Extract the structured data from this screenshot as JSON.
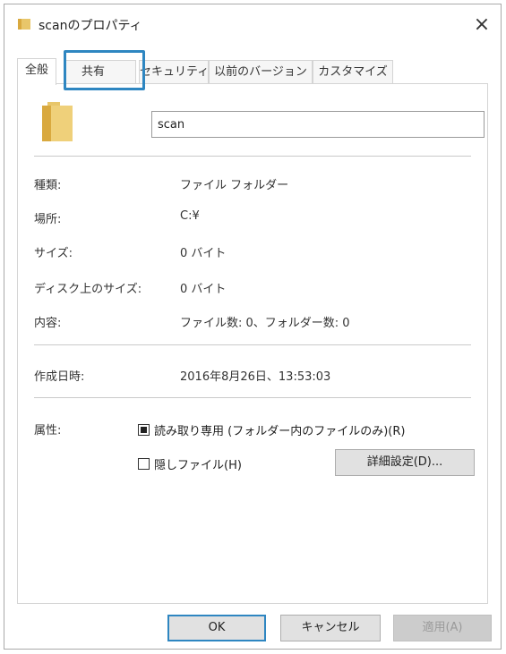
{
  "window": {
    "title": "scanのプロパティ",
    "close_glyph": "×",
    "folder_icon_color": "#e8c66a"
  },
  "tabs": [
    {
      "label": "全般",
      "active": true
    },
    {
      "label": "共有",
      "active": false,
      "highlighted": true
    },
    {
      "label": "セキュリティ",
      "active": false
    },
    {
      "label": "以前のバージョン",
      "active": false
    },
    {
      "label": "カスタマイズ",
      "active": false
    }
  ],
  "highlight_color": "#2e86c1",
  "general": {
    "folder_name": "scan",
    "rows": [
      {
        "label": "種類:",
        "value": "ファイル フォルダー"
      },
      {
        "label": "場所:",
        "value": "C:¥"
      },
      {
        "label": "サイズ:",
        "value": "0 バイト"
      },
      {
        "label": "ディスク上のサイズ:",
        "value": "0 バイト"
      },
      {
        "label": "内容:",
        "value": "ファイル数: 0、フォルダー数: 0"
      }
    ],
    "created_label": "作成日時:",
    "created_value": "2016年8月26日、13:53:03",
    "attributes_label": "属性:",
    "readonly_label": "読み取り専用 (フォルダー内のファイルのみ)(R)",
    "readonly_state": "indeterminate",
    "hidden_label": "隠しファイル(H)",
    "hidden_checked": false,
    "advanced_button": "詳細設定(D)..."
  },
  "buttons": {
    "ok": "OK",
    "cancel": "キャンセル",
    "apply": "適用(A)"
  }
}
